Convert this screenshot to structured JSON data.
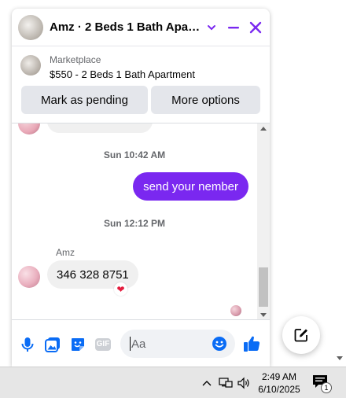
{
  "chat": {
    "title": "Amz · 2 Beds 1 Bath Apart...",
    "accent_color": "#7a28f0",
    "header_icons": [
      "chevron-down-icon",
      "minimize-icon",
      "close-icon"
    ]
  },
  "listing": {
    "source": "Marketplace",
    "title": "$550 - 2 Beds 1 Bath Apartment",
    "mark_pending_label": "Mark as pending",
    "more_options_label": "More options"
  },
  "messages": {
    "timestamp_1": "Sun 10:42 AM",
    "outgoing_text": "send your nember",
    "timestamp_2": "Sun 12:12 PM",
    "sender_name": "Amz",
    "incoming_text": "346 328 8751",
    "reaction": "❤"
  },
  "composer": {
    "placeholder": "Aa",
    "icons": [
      "microphone-icon",
      "photo-icon",
      "sticker-icon",
      "gif-icon",
      "emoji-icon",
      "thumbs-up-icon"
    ],
    "gif_label": "GIF"
  },
  "taskbar": {
    "time": "2:49 AM",
    "date": "6/10/2025",
    "notification_count": "1"
  }
}
